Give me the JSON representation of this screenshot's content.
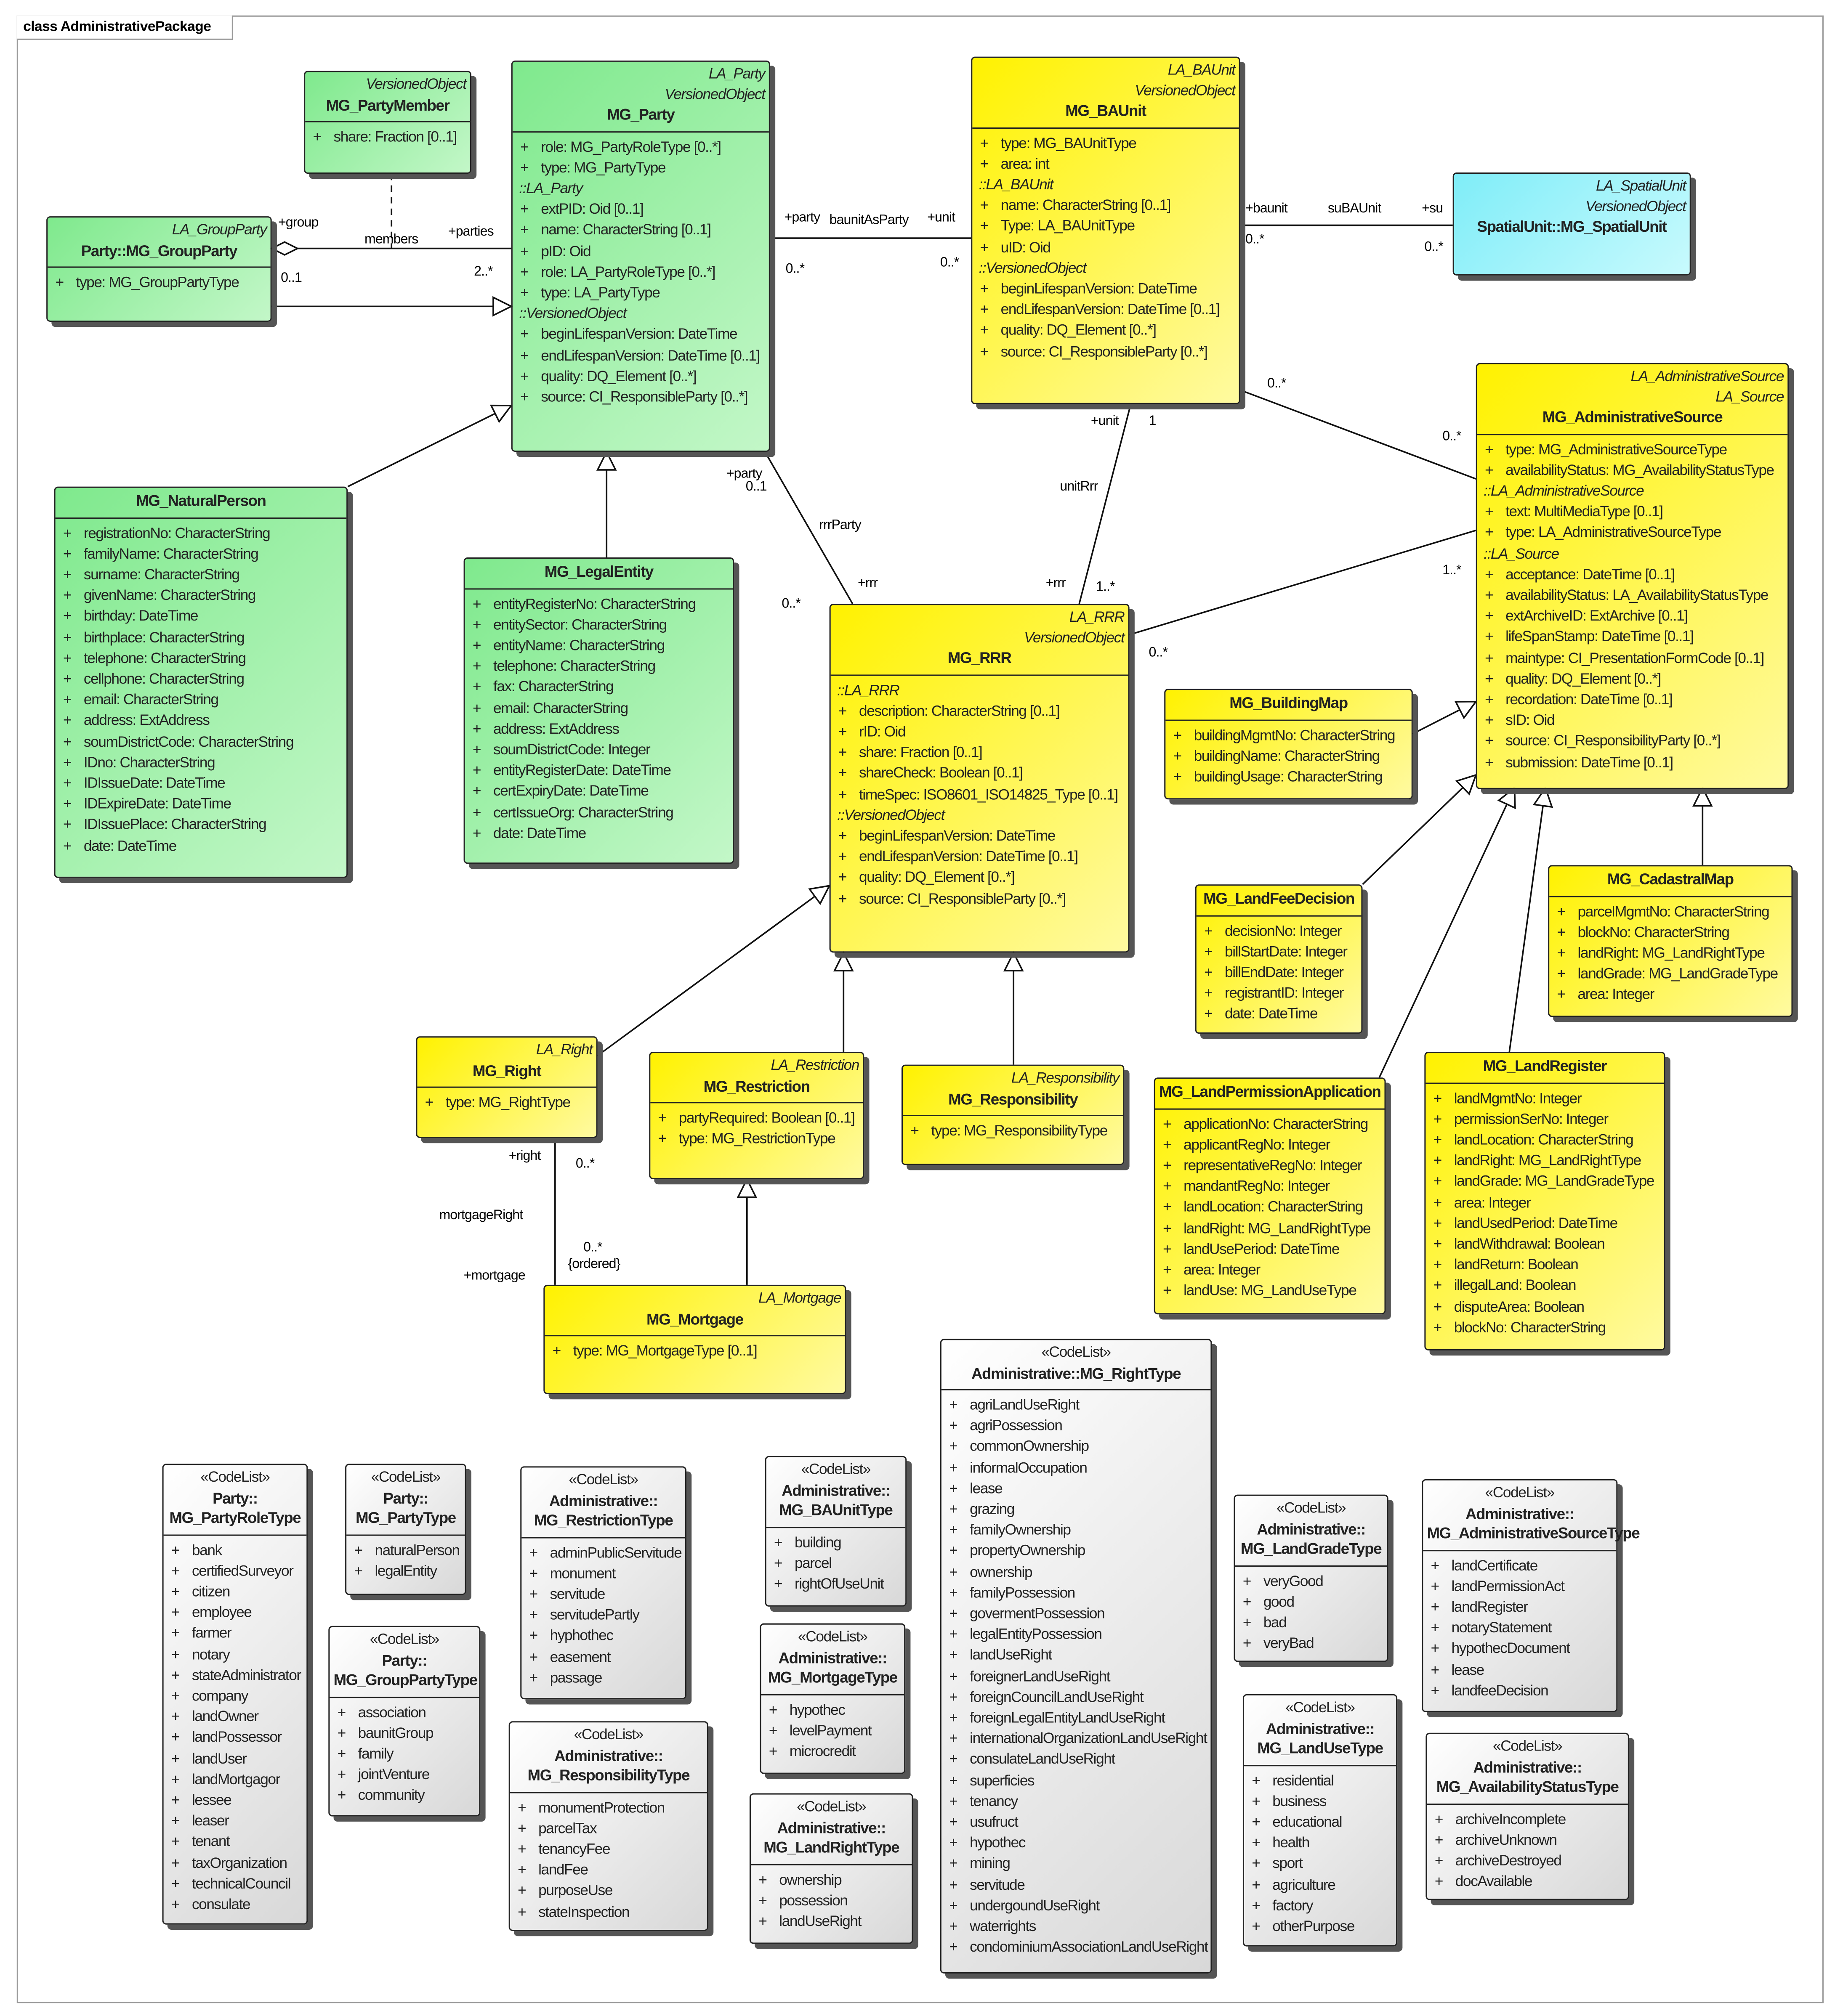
{
  "frame_title": "class AdministrativePackage",
  "colors": {
    "green": "#8ef09a",
    "yellow": "#fff85a",
    "cyan": "#8ff2fb",
    "codelist": "#e6e6e6"
  },
  "classes": [
    {
      "id": "PartyMember",
      "kind": "green",
      "header": [
        {
          "t": "VersionedObject",
          "s": "i"
        },
        {
          "t": "MG_PartyMember",
          "s": "b"
        }
      ],
      "compartments": [
        [
          "share: Fraction [0..1]"
        ]
      ]
    },
    {
      "id": "Party",
      "kind": "green",
      "header": [
        {
          "t": "LA_Party",
          "s": "i"
        },
        {
          "t": "VersionedObject",
          "s": "i"
        },
        {
          "t": "MG_Party",
          "s": "b"
        }
      ],
      "compartments": [
        [
          "role: MG_PartyRoleType [0..*]",
          "type: MG_PartyType",
          "::LA_Party",
          "extPID: Oid [0..1]",
          "name: CharacterString [0..1]",
          "pID: Oid",
          "role: LA_PartyRoleType [0..*]",
          "type: LA_PartyType",
          "::VersionedObject",
          "beginLifespanVersion: DateTime",
          "endLifespanVersion: DateTime [0..1]",
          "quality: DQ_Element [0..*]",
          "source: CI_ResponsibleParty [0..*]"
        ]
      ]
    },
    {
      "id": "GroupParty",
      "kind": "green",
      "header": [
        {
          "t": "LA_GroupParty",
          "s": "i"
        },
        {
          "t": "Party::MG_GroupParty",
          "s": "b"
        }
      ],
      "compartments": [
        [
          "type: MG_GroupPartyType"
        ]
      ]
    },
    {
      "id": "NaturalPerson",
      "kind": "green",
      "header": [
        {
          "t": "MG_NaturalPerson",
          "s": "b"
        }
      ],
      "compartments": [
        [
          "registrationNo: CharacterString",
          "familyName: CharacterString",
          "surname: CharacterString",
          "givenName: CharacterString",
          "birthday: DateTime",
          "birthplace: CharacterString",
          "telephone: CharacterString",
          "cellphone: CharacterString",
          "email: CharacterString",
          "address: ExtAddress",
          "soumDistrictCode: CharacterString",
          "IDno: CharacterString",
          "IDIssueDate: DateTime",
          "IDExpireDate: DateTime",
          "IDIssuePlace: CharacterString",
          "date: DateTime"
        ]
      ]
    },
    {
      "id": "LegalEntity",
      "kind": "green",
      "header": [
        {
          "t": "MG_LegalEntity",
          "s": "b"
        }
      ],
      "compartments": [
        [
          "entityRegisterNo: CharacterString",
          "entitySector: CharacterString",
          "entityName: CharacterString",
          "telephone: CharacterString",
          "fax: CharacterString",
          "email: CharacterString",
          "address: ExtAddress",
          "soumDistrictCode: Integer",
          "entityRegisterDate: DateTime",
          "certExpiryDate: DateTime",
          "certIssueOrg: CharacterString",
          "date: DateTime"
        ]
      ]
    },
    {
      "id": "BAUnit",
      "kind": "yellow",
      "header": [
        {
          "t": "LA_BAUnit",
          "s": "i"
        },
        {
          "t": "VersionedObject",
          "s": "i"
        },
        {
          "t": "MG_BAUnit",
          "s": "b"
        }
      ],
      "compartments": [
        [
          "type: MG_BAUnitType",
          "area: int",
          "::LA_BAUnit",
          "name: CharacterString [0..1]",
          "Type: LA_BAUnitType",
          "uID: Oid",
          "::VersionedObject",
          "beginLifespanVersion: DateTime",
          "endLifespanVersion: DateTime [0..1]",
          "quality: DQ_Element [0..*]",
          "source: CI_ResponsibleParty [0..*]"
        ]
      ]
    },
    {
      "id": "SpatialUnit",
      "kind": "cyan",
      "header": [
        {
          "t": "LA_SpatialUnit",
          "s": "i"
        },
        {
          "t": "VersionedObject",
          "s": "i"
        },
        {
          "t": "SpatialUnit::MG_SpatialUnit",
          "s": "b"
        }
      ],
      "compartments": []
    },
    {
      "id": "AdminSource",
      "kind": "yellow",
      "header": [
        {
          "t": "LA_AdministrativeSource",
          "s": "i"
        },
        {
          "t": "LA_Source",
          "s": "i"
        },
        {
          "t": "MG_AdministrativeSource",
          "s": "b"
        }
      ],
      "compartments": [
        [
          "type: MG_AdministrativeSourceType",
          "availabilityStatus: MG_AvailabilityStatusType",
          "::LA_AdministrativeSource",
          "text: MultiMediaType [0..1]",
          "type: LA_AdministrativeSourceType",
          "::LA_Source",
          "acceptance: DateTime [0..1]",
          "availabilityStatus: LA_AvailabilityStatusType",
          "extArchiveID: ExtArchive [0..1]",
          "lifeSpanStamp: DateTime [0..1]",
          "maintype: CI_PresentationFormCode [0..1]",
          "quality: DQ_Element [0..*]",
          "recordation: DateTime [0..1]",
          "sID: Oid",
          "source: CI_ResponsibilityParty [0..*]",
          "submission: DateTime [0..1]"
        ]
      ]
    },
    {
      "id": "RRR",
      "kind": "yellow",
      "header": [
        {
          "t": "LA_RRR",
          "s": "i"
        },
        {
          "t": "VersionedObject",
          "s": "i"
        },
        {
          "t": "MG_RRR",
          "s": "b"
        }
      ],
      "compartments": [
        [
          "::LA_RRR",
          "description: CharacterString [0..1]",
          "rID: Oid",
          "share: Fraction [0..1]",
          "shareCheck: Boolean [0..1]",
          "timeSpec: ISO8601_ISO14825_Type [0..1]",
          "::VersionedObject",
          "beginLifespanVersion: DateTime",
          "endLifespanVersion: DateTime [0..1]",
          "quality: DQ_Element [0..*]",
          "source: CI_ResponsibleParty [0..*]"
        ]
      ]
    },
    {
      "id": "BuildingMap",
      "kind": "yellow",
      "header": [
        {
          "t": "MG_BuildingMap",
          "s": "b"
        }
      ],
      "compartments": [
        [
          "buildingMgmtNo: CharacterString",
          "buildingName: CharacterString",
          "buildingUsage: CharacterString"
        ]
      ]
    },
    {
      "id": "LandFeeDecision",
      "kind": "yellow",
      "header": [
        {
          "t": "MG_LandFeeDecision",
          "s": "b"
        }
      ],
      "compartments": [
        [
          "decisionNo: Integer",
          "billStartDate: Integer",
          "billEndDate: Integer",
          "registrantID: Integer",
          "date: DateTime"
        ]
      ]
    },
    {
      "id": "CadastralMap",
      "kind": "yellow",
      "header": [
        {
          "t": "MG_CadastralMap",
          "s": "b"
        }
      ],
      "compartments": [
        [
          "parcelMgmtNo: CharacterString",
          "blockNo: CharacterString",
          "landRight: MG_LandRightType",
          "landGrade: MG_LandGradeType",
          "area: Integer"
        ]
      ]
    },
    {
      "id": "LandPermission",
      "kind": "yellow",
      "header": [
        {
          "t": "MG_LandPermissionApplication",
          "s": "b"
        }
      ],
      "compartments": [
        [
          "applicationNo: CharacterString",
          "applicantRegNo: Integer",
          "representativeRegNo: Integer",
          "mandantRegNo: Integer",
          "landLocation: CharacterString",
          "landRight: MG_LandRightType",
          "landUsePeriod: DateTime",
          "area: Integer",
          "landUse: MG_LandUseType"
        ]
      ]
    },
    {
      "id": "LandRegister",
      "kind": "yellow",
      "header": [
        {
          "t": "MG_LandRegister",
          "s": "b"
        }
      ],
      "compartments": [
        [
          "landMgmtNo: Integer",
          "permissionSerNo: Integer",
          "landLocation: CharacterString",
          "landRight: MG_LandRightType",
          "landGrade: MG_LandGradeType",
          "area: Integer",
          "landUsedPeriod: DateTime",
          "landWithdrawal: Boolean",
          "landReturn: Boolean",
          "illegalLand: Boolean",
          "disputeArea: Boolean",
          "blockNo: CharacterString"
        ]
      ]
    },
    {
      "id": "Right",
      "kind": "yellow",
      "header": [
        {
          "t": "LA_Right",
          "s": "i"
        },
        {
          "t": "MG_Right",
          "s": "b"
        }
      ],
      "compartments": [
        [
          "type: MG_RightType"
        ]
      ]
    },
    {
      "id": "Restriction",
      "kind": "yellow",
      "header": [
        {
          "t": "LA_Restriction",
          "s": "i"
        },
        {
          "t": "MG_Restriction",
          "s": "b"
        }
      ],
      "compartments": [
        [
          "partyRequired: Boolean [0..1]",
          "type: MG_RestrictionType"
        ]
      ]
    },
    {
      "id": "Responsibility",
      "kind": "yellow",
      "header": [
        {
          "t": "LA_Responsibility",
          "s": "i"
        },
        {
          "t": "MG_Responsibility",
          "s": "b"
        }
      ],
      "compartments": [
        [
          "type: MG_ResponsibilityType"
        ]
      ]
    },
    {
      "id": "Mortgage",
      "kind": "yellow",
      "header": [
        {
          "t": "LA_Mortgage",
          "s": "i"
        },
        {
          "t": "MG_Mortgage",
          "s": "b"
        }
      ],
      "compartments": [
        [
          "type: MG_MortgageType [0..1]"
        ]
      ]
    },
    {
      "id": "CLPartyRole",
      "kind": "gray",
      "header": [
        {
          "t": "«CodeList»",
          "s": "c"
        },
        {
          "t": "Party::",
          "s": "b"
        },
        {
          "t": "MG_PartyRoleType",
          "s": "b"
        }
      ],
      "compartments": [
        [
          "bank",
          "certifiedSurveyor",
          "citizen",
          "employee",
          "farmer",
          "notary",
          "stateAdministrator",
          "company",
          "landOwner",
          "landPossessor",
          "landUser",
          "landMortgagor",
          "lessee",
          "leaser",
          "tenant",
          "taxOrganization",
          "technicalCouncil",
          "consulate"
        ]
      ]
    },
    {
      "id": "CLPartyType",
      "kind": "gray",
      "header": [
        {
          "t": "«CodeList»",
          "s": "c"
        },
        {
          "t": "Party::",
          "s": "b"
        },
        {
          "t": "MG_PartyType",
          "s": "b"
        }
      ],
      "compartments": [
        [
          "naturalPerson",
          "legalEntity"
        ]
      ]
    },
    {
      "id": "CLGroupParty",
      "kind": "gray",
      "header": [
        {
          "t": "«CodeList»",
          "s": "c"
        },
        {
          "t": "Party::",
          "s": "b"
        },
        {
          "t": "MG_GroupPartyType",
          "s": "b"
        }
      ],
      "compartments": [
        [
          "association",
          "baunitGroup",
          "family",
          "jointVenture",
          "community"
        ]
      ]
    },
    {
      "id": "CLRestriction",
      "kind": "gray",
      "header": [
        {
          "t": "«CodeList»",
          "s": "c"
        },
        {
          "t": "Administrative::",
          "s": "b"
        },
        {
          "t": "MG_RestrictionType",
          "s": "b"
        }
      ],
      "compartments": [
        [
          "adminPublicServitude",
          "monument",
          "servitude",
          "servitudePartly",
          "hyphothec",
          "easement",
          "passage"
        ]
      ]
    },
    {
      "id": "CLResponsibility",
      "kind": "gray",
      "header": [
        {
          "t": "«CodeList»",
          "s": "c"
        },
        {
          "t": "Administrative::",
          "s": "b"
        },
        {
          "t": "MG_ResponsibilityType",
          "s": "b"
        }
      ],
      "compartments": [
        [
          "monumentProtection",
          "parcelTax",
          "tenancyFee",
          "landFee",
          "purposeUse",
          "stateInspection"
        ]
      ]
    },
    {
      "id": "CLBAUnit",
      "kind": "gray",
      "header": [
        {
          "t": "«CodeList»",
          "s": "c"
        },
        {
          "t": "Administrative::",
          "s": "b"
        },
        {
          "t": "MG_BAUnitType",
          "s": "b"
        }
      ],
      "compartments": [
        [
          "building",
          "parcel",
          "rightOfUseUnit"
        ]
      ]
    },
    {
      "id": "CLMortgage",
      "kind": "gray",
      "header": [
        {
          "t": "«CodeList»",
          "s": "c"
        },
        {
          "t": "Administrative::",
          "s": "b"
        },
        {
          "t": "MG_MortgageType",
          "s": "b"
        }
      ],
      "compartments": [
        [
          "hypothec",
          "levelPayment",
          "microcredit"
        ]
      ]
    },
    {
      "id": "CLLandRight",
      "kind": "gray",
      "header": [
        {
          "t": "«CodeList»",
          "s": "c"
        },
        {
          "t": "Administrative::",
          "s": "b"
        },
        {
          "t": "MG_LandRightType",
          "s": "b"
        }
      ],
      "compartments": [
        [
          "ownership",
          "possession",
          "landUseRight"
        ]
      ]
    },
    {
      "id": "CLRight",
      "kind": "gray",
      "header": [
        {
          "t": "«CodeList»",
          "s": "c"
        },
        {
          "t": "Administrative::MG_RightType",
          "s": "b"
        }
      ],
      "compartments": [
        [
          "agriLandUseRight",
          "agriPossession",
          "commonOwnership",
          "informalOccupation",
          "lease",
          "grazing",
          "familyOwnership",
          "propertyOwnership",
          "ownership",
          "familyPossession",
          "govermentPossession",
          "legalEntityPossession",
          "landUseRight",
          "foreignerLandUseRight",
          "foreignCouncilLandUseRight",
          "foreignLegalEntityLandUseRight",
          "internationalOrganizationLandUseRight",
          "consulateLandUseRight",
          "superficies",
          "tenancy",
          "usufruct",
          "hypothec",
          "mining",
          "servitude",
          "undergoundUseRight",
          "waterrights",
          "condominiumAssociationLandUseRight"
        ]
      ]
    },
    {
      "id": "CLLandGrade",
      "kind": "gray",
      "header": [
        {
          "t": "«CodeList»",
          "s": "c"
        },
        {
          "t": "Administrative::",
          "s": "b"
        },
        {
          "t": "MG_LandGradeType",
          "s": "b"
        }
      ],
      "compartments": [
        [
          "veryGood",
          "good",
          "bad",
          "veryBad"
        ]
      ]
    },
    {
      "id": "CLLandUse",
      "kind": "gray",
      "header": [
        {
          "t": "«CodeList»",
          "s": "c"
        },
        {
          "t": "Administrative::",
          "s": "b"
        },
        {
          "t": "MG_LandUseType",
          "s": "b"
        }
      ],
      "compartments": [
        [
          "residential",
          "business",
          "educational",
          "health",
          "sport",
          "agriculture",
          "factory",
          "otherPurpose"
        ]
      ]
    },
    {
      "id": "CLAdminSource",
      "kind": "gray",
      "header": [
        {
          "t": "«CodeList»",
          "s": "c"
        },
        {
          "t": "Administrative::",
          "s": "b"
        },
        {
          "t": "MG_AdministrativeSourceType",
          "s": "b"
        }
      ],
      "compartments": [
        [
          "landCertificate",
          "landPermissionAct",
          "landRegister",
          "notaryStatement",
          "hypothecDocument",
          "lease",
          "landfeeDecision"
        ]
      ]
    },
    {
      "id": "CLAvailability",
      "kind": "gray",
      "header": [
        {
          "t": "«CodeList»",
          "s": "c"
        },
        {
          "t": "Administrative::",
          "s": "b"
        },
        {
          "t": "MG_AvailabilityStatusType",
          "s": "b"
        }
      ],
      "compartments": [
        [
          "archiveIncomplete",
          "archiveUnknown",
          "archiveDestroyed",
          "docAvailable"
        ]
      ]
    }
  ],
  "labels": {
    "group_role": "+group",
    "members_assoc": "members",
    "parties_role": "+parties",
    "group_mult": "0..1",
    "parties_mult": "2..*",
    "party_role": "+party",
    "baunitAsParty": "baunitAsParty",
    "unit_role": "+unit",
    "party_mult": "0..*",
    "unit_mult": "0..*",
    "baunit_role": "+baunit",
    "suBAUnit": "suBAUnit",
    "su_role": "+su",
    "baunit_mult": "0..*",
    "su_mult": "0..*",
    "ba_src_mult1": "0..*",
    "ba_src_mult2": "0..*",
    "unitrrr_unit_role": "+unit",
    "unitrrr_unit_mult": "1",
    "unitRrr": "unitRrr",
    "unitrrr_rrr_role": "+rrr",
    "unitrrr_rrr_mult": "1..*",
    "rrrparty_party_role": "+party",
    "rrrparty_party_mult": "0..1",
    "rrrParty": "rrrParty",
    "rrrparty_rrr_role": "+rrr",
    "rrrparty_rrr_mult": "0..*",
    "rrr_src_mult1": "1..*",
    "rrr_src_mult2": "0..*",
    "right_role": "+right",
    "right_mult": "0..*",
    "mortgageRight": "mortgageRight",
    "mortgage_mult": "0..*",
    "ordered": "{ordered}",
    "mortgage_role": "+mortgage"
  }
}
